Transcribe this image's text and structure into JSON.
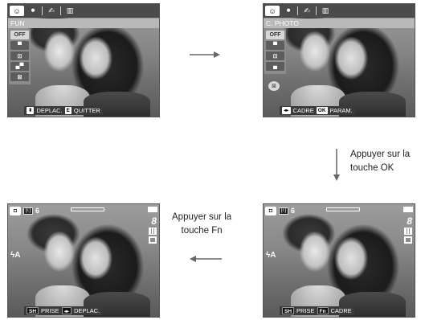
{
  "screen1": {
    "tabs": [
      "☺",
      "⚫",
      "✍",
      "▥"
    ],
    "title": "FUN",
    "menu_items": [
      "OFF",
      "▀",
      "⊡",
      "▄▀",
      "⊠"
    ],
    "footer": {
      "key1": "⬍",
      "label1": "DEPLAC.",
      "key2": "E",
      "label2": "QUITTER"
    }
  },
  "screen2": {
    "tabs": [
      "☺",
      "⚫",
      "✍",
      "▥"
    ],
    "title": "C. PHOTO",
    "menu_items": [
      "OFF",
      "▀",
      "⊡",
      "▄"
    ],
    "selected_item": "⊠",
    "footer": {
      "key1": "◂▸",
      "label1": "CADRE",
      "key2": "OK",
      "label2": "PARAM."
    }
  },
  "screen3": {
    "mode_label": "[i:]",
    "shot_count": "6",
    "size": "8",
    "flash": "ϟA",
    "footer": {
      "key1": "SH",
      "label1": "PRISE",
      "key2": "Fn",
      "label2": "CADRE"
    }
  },
  "screen4": {
    "mode_label": "[i:]",
    "shot_count": "6",
    "size": "8",
    "flash": "ϟA",
    "footer": {
      "key1": "SH",
      "label1": "PRISE",
      "key2": "◂▸",
      "label2": "DEPLAC."
    }
  },
  "captions": {
    "ok": [
      "Appuyer sur la",
      "touche OK"
    ],
    "fn": [
      "Appuyer sur la",
      "touche Fn"
    ]
  },
  "colors": {
    "menu_bar": "#4b4b4b",
    "title_bar": "#b9b9b9",
    "footer_bar": "#3a3a3a"
  }
}
